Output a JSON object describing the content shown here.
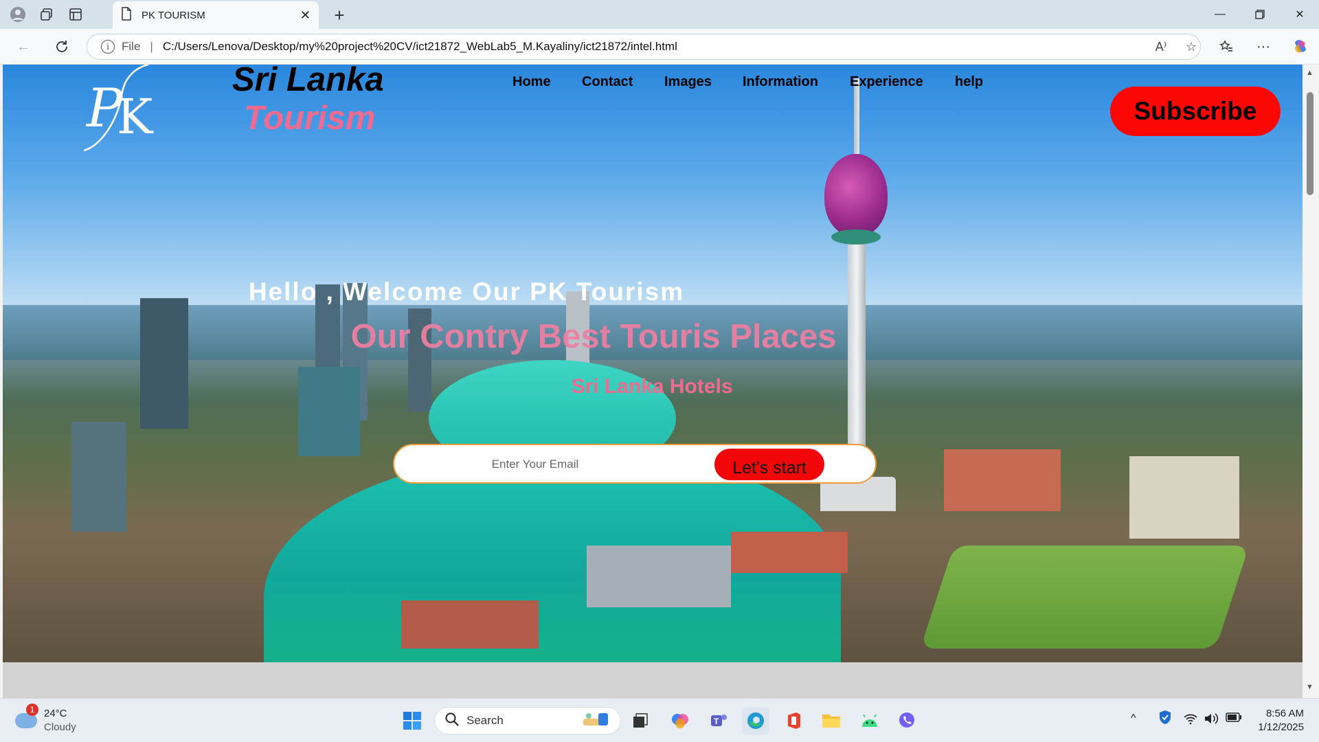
{
  "browser": {
    "tab_title": "PK TOURISM",
    "url_scheme": "File",
    "url": "C:/Users/Lenova/Desktop/my%20project%20CV/ict21872_WebLab5_M.Kayaliny/ict21872/intel.html",
    "new_tab_symbol": "+",
    "read_aloud_symbol": "A⁾",
    "more_symbol": "···"
  },
  "page": {
    "brand_line1": "Sri Lanka",
    "brand_line2": "Tourism",
    "nav": [
      "Home",
      "Contact",
      "Images",
      "Information",
      "Experience",
      "help"
    ],
    "subscribe_label": "Subscribe",
    "welcome": "Hello , Welcome Our PK Tourism",
    "headline": "Our Contry Best Touris Places",
    "subheadline": "Sri Lanka Hotels",
    "email_placeholder": "Enter Your Email",
    "start_label": "Let's start"
  },
  "taskbar": {
    "weather_temp": "24°C",
    "weather_desc": "Cloudy",
    "weather_badge": "1",
    "search_label": "Search",
    "time": "8:56 AM",
    "date": "1/12/2025"
  },
  "colors": {
    "accent_red": "#fc0606",
    "brand_pink": "#f06b8f",
    "form_border": "#f29a3a"
  }
}
